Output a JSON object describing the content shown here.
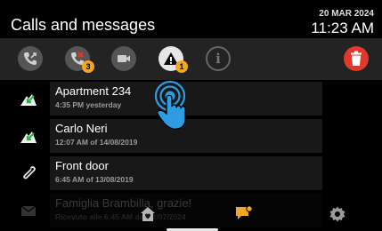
{
  "header": {
    "title": "Calls and messages",
    "date": "20 MAR 2024",
    "time": "11:23 AM"
  },
  "toolbar": {
    "filters": [
      {
        "icon": "all-calls-icon",
        "badge": ""
      },
      {
        "icon": "missed-call-icon",
        "badge": "3"
      },
      {
        "icon": "video-icon",
        "badge": ""
      },
      {
        "icon": "alert-icon",
        "badge": "1"
      },
      {
        "icon": "info-icon",
        "glyph": "i",
        "badge": ""
      }
    ],
    "delete_icon": "trash-icon"
  },
  "messages": [
    {
      "icon": "incoming-call-icon",
      "name": "Apartment 234",
      "subtitle": "4:35 PM yesterday"
    },
    {
      "icon": "incoming-call-icon",
      "name": "Carlo Neri",
      "subtitle": "12:07 AM of 14/08/2019"
    },
    {
      "icon": "attachment-icon",
      "name": "Front door",
      "subtitle": "6:45 AM of 13/08/2019"
    },
    {
      "icon": "mail-icon",
      "name": "Famiglia Brambilla, grazie!",
      "subtitle": "Ricevuto alle 6:45 AM del 12/07/2024"
    }
  ],
  "bottom_nav": {
    "items": [
      "home-icon",
      "messages-icon",
      "settings-icon"
    ],
    "active": "messages-icon"
  },
  "colors": {
    "accent": "#f0a820",
    "danger": "#e03a2f",
    "touch": "#2f9be0",
    "green": "#2ab24a"
  }
}
